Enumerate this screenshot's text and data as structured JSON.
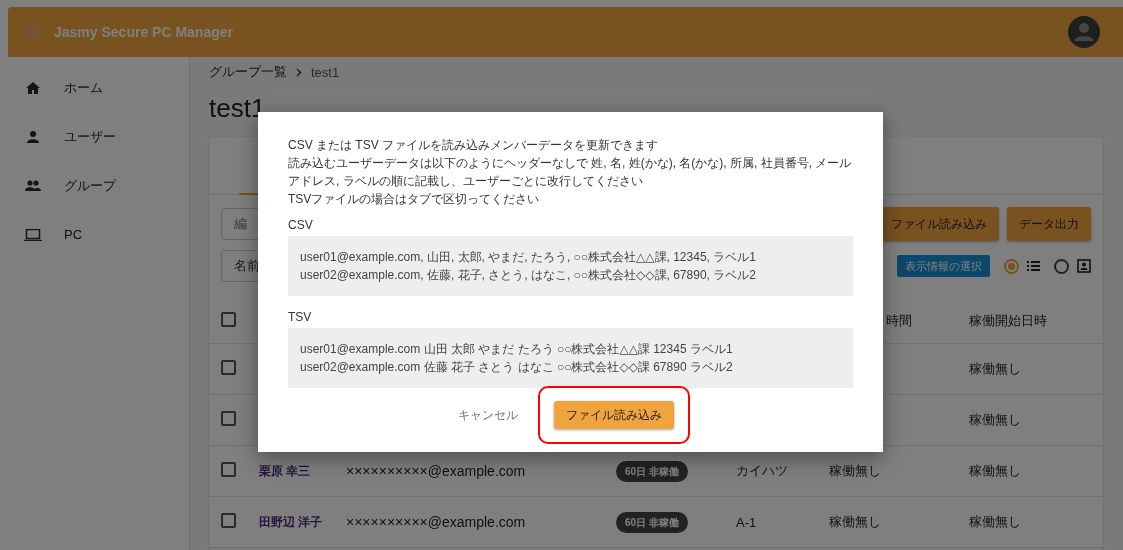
{
  "app_bar": {
    "title": "Jasmy Secure PC Manager"
  },
  "sidebar": {
    "items": [
      {
        "label": "ホーム",
        "kind": "home"
      },
      {
        "label": "ユーザー",
        "kind": "person"
      },
      {
        "label": "グループ",
        "kind": "group"
      },
      {
        "label": "PC",
        "kind": "laptop"
      }
    ]
  },
  "breadcrumb": [
    "グループ一覧",
    "test1"
  ],
  "page_title": "test1",
  "toolbar": {
    "fields": [
      "編",
      "名前"
    ],
    "buttons": [
      "ファイル読み込み",
      "データ出力"
    ],
    "display_chip": "表示情報の選択",
    "view_options": [
      {
        "kind": "list",
        "selected": true
      },
      {
        "kind": "card",
        "selected": false
      }
    ]
  },
  "table": {
    "header_checked": false,
    "columns": [
      "時間",
      "稼働開始日時"
    ],
    "rows": [
      {
        "checked": false,
        "column_7": "稼働無し"
      },
      {
        "checked": false,
        "column_7": "稼働無し"
      },
      {
        "checked": false,
        "name": "栗原 幸三",
        "email": "××××××××××@example.com",
        "badge": "60日 非稼働",
        "column_5": "カイハツ",
        "column_6": "稼働無し",
        "column_7": "稼働無し"
      },
      {
        "checked": false,
        "name": "田野辺 洋子",
        "email": "××××××××××@example.com",
        "badge": "60日 非稼働",
        "column_5": "A-1",
        "column_6": "稼働無し",
        "column_7": "稼働無し"
      }
    ]
  },
  "dialog": {
    "description": [
      "CSV または TSV ファイルを読み込みメンバーデータを更新できます",
      "読み込むユーザーデータは以下のようにヘッダーなしで 姓, 名, 姓(かな), 名(かな), 所属, 社員番号, メールアドレス, ラベルの順に記載し、ユーザーごとに改行してください",
      "TSVファイルの場合はタブで区切ってください"
    ],
    "examples": [
      {
        "label": "CSV",
        "lines": [
          "user01@example.com, 山田, 太郎, やまだ, たろう, ○○株式会社△△課, 12345, ラベル1",
          "user02@example.com, 佐藤, 花子, さとう, はなこ, ○○株式会社◇◇課, 67890, ラベル2"
        ]
      },
      {
        "label": "TSV",
        "lines": [
          "user01@example.com 山田 太郎 やまだ たろう ○○株式会社△△課 12345 ラベル1",
          "user02@example.com 佐藤 花子 さとう はなこ ○○株式会社◇◇課 67890 ラベル2"
        ]
      }
    ],
    "cancel": "キャンセル",
    "confirm": "ファイル読み込み",
    "confirm_highlighted": true
  }
}
